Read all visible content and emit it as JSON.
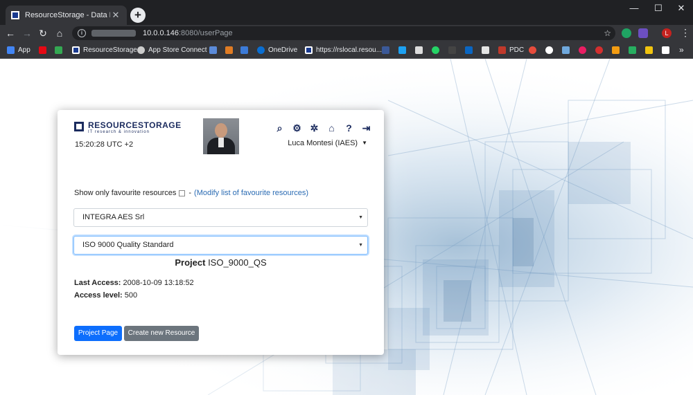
{
  "browser": {
    "tab_title": "ResourceStorage - Data Manager",
    "new_tab": "+",
    "url_host": "10.0.0.146",
    "url_rest": ":8080/userPage",
    "profile_initial": "L",
    "bookmarks": [
      {
        "label": "App",
        "color": "#4285f4"
      },
      {
        "label": "",
        "color": "#e50914"
      },
      {
        "label": "",
        "color": "#34a853"
      },
      {
        "label": "ResourceStorage",
        "color": "#1a3a8f"
      },
      {
        "label": "App Store Connect",
        "color": "#cccccc"
      },
      {
        "label": "",
        "color": "#5b8bd9"
      },
      {
        "label": "",
        "color": "#e07c24"
      },
      {
        "label": "",
        "color": "#3c7bd8"
      },
      {
        "label": "OneDrive",
        "color": "#0a6ed1"
      },
      {
        "label": "https://rslocal.resou...",
        "color": "#1a3a8f"
      }
    ]
  },
  "app": {
    "brand": "RESOURCESTORAGE",
    "brand_tagline": "IT research & innovation",
    "time": "15:20:28 UTC +2",
    "user_name": "Luca Montesi (IAES)",
    "toolbar_icons": [
      "search-icon",
      "gear-icon",
      "settings-cog-icon",
      "home-icon",
      "help-icon",
      "logout-icon"
    ],
    "favourites_label": "Show only favourite resources",
    "favourites_separator": "-",
    "favourites_link": "(Modify list of favourite resources)",
    "company_select": "INTEGRA AES Srl",
    "project_select": "ISO 9000 Quality Standard",
    "project_label": "Project",
    "project_code": "ISO_9000_QS",
    "last_access_label": "Last Access:",
    "last_access_value": "2008-10-09 13:18:52",
    "access_level_label": "Access level:",
    "access_level_value": "500",
    "project_page_button": "Project Page",
    "create_resource_button": "Create new Resource"
  }
}
